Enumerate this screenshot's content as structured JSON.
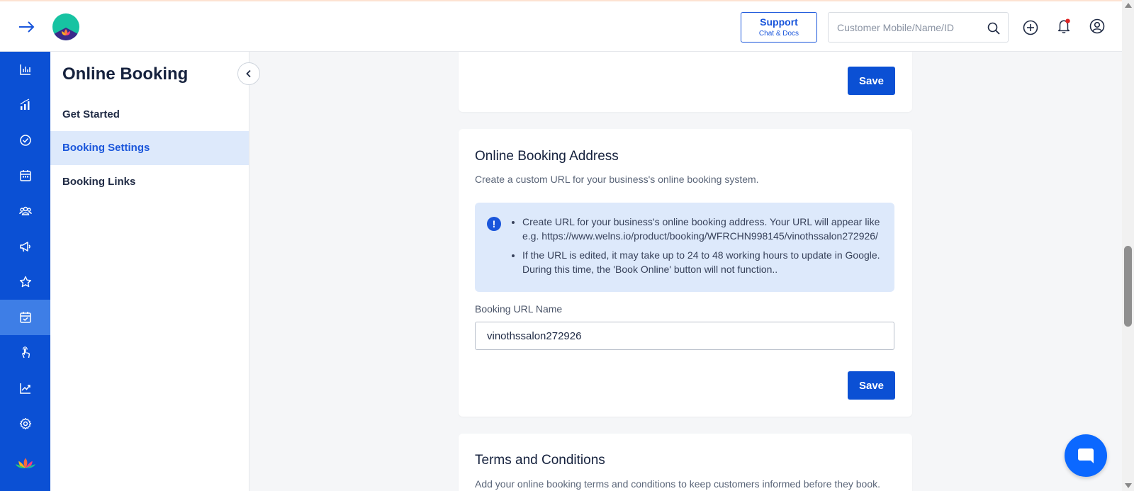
{
  "header": {
    "support_label": "Support",
    "support_sublabel": "Chat & Docs",
    "search_placeholder": "Customer Mobile/Name/ID"
  },
  "rail": {
    "items": [
      {
        "icon": "bar-chart-icon"
      },
      {
        "icon": "signal-bars-icon"
      },
      {
        "icon": "check-circle-icon"
      },
      {
        "icon": "calendar-icon"
      },
      {
        "icon": "users-icon"
      },
      {
        "icon": "megaphone-icon"
      },
      {
        "icon": "star-icon"
      },
      {
        "icon": "calendar-check-icon",
        "active": true
      },
      {
        "icon": "hand-pointer-icon"
      },
      {
        "icon": "trend-chart-icon"
      },
      {
        "icon": "gear-icon"
      }
    ]
  },
  "subnav": {
    "title": "Online Booking",
    "items": [
      {
        "label": "Get Started"
      },
      {
        "label": "Booking Settings",
        "active": true
      },
      {
        "label": "Booking Links"
      }
    ]
  },
  "cards": {
    "top": {
      "save_label": "Save"
    },
    "address": {
      "title": "Online Booking Address",
      "description": "Create a custom URL for your business's online booking system.",
      "info_icon": "!",
      "info_items": [
        "Create URL for your business's online booking address. Your URL will appear like e.g. https://www.welns.io/product/booking/WFRCHN998145/vinothssalon272926/",
        "If the URL is edited, it may take up to 24 to 48 working hours to update in Google. During this time, the 'Book Online' button will not function.."
      ],
      "field_label": "Booking URL Name",
      "field_value": "vinothssalon272926",
      "save_label": "Save"
    },
    "terms": {
      "title": "Terms and Conditions",
      "description": "Add your online booking terms and conditions to keep customers informed before they book."
    }
  },
  "colors": {
    "primary": "#0b50d4",
    "rail_active": "#3e7ee6",
    "info_bg": "#dde9fb",
    "fab": "#0b68ff"
  }
}
